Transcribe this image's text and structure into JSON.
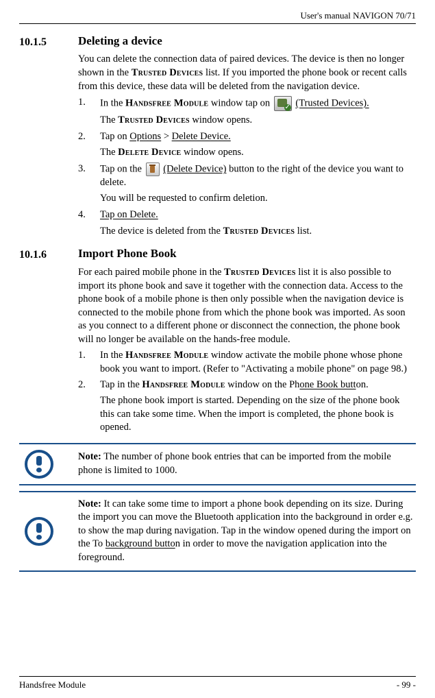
{
  "header_right": "User's manual NAVIGON 70/71",
  "sections": [
    {
      "number": "10.1.5",
      "title": "Deleting a device",
      "intro_part1": "You can delete the connection data of paired devices. The device is then no longer shown in the ",
      "intro_sc1": "Trusted Devices",
      "intro_part2": " list. If you imported the phone book or recent calls from this device, these data will be deleted from the navigation device.",
      "step1_a": "In the ",
      "step1_sc": "Handsfree Module",
      "step1_b": " window tap on ",
      "step1_link": " (Trusted Devices).",
      "step1_sub_a": "The ",
      "step1_sub_sc": "Trusted Devices",
      "step1_sub_b": " window opens.",
      "step2_a": "Tap on ",
      "step2_link1": "Options",
      "step2_gt": " > ",
      "step2_link2": "Delete Device.",
      "step2_sub_a": "The ",
      "step2_sub_sc": "Delete Device",
      "step2_sub_b": " window opens.",
      "step3_a": "Tap on the ",
      "step3_link": " (Delete Device)",
      "step3_b": " button to the right of the device you want to delete.",
      "step3_sub": "You will be requested to confirm deletion.",
      "step4_link": "Tap on Delete.",
      "step4_sub_a": "The device is deleted from the ",
      "step4_sub_sc": "Trusted Devices",
      "step4_sub_b": " list."
    },
    {
      "number": "10.1.6",
      "title": "Import Phone Book",
      "intro_a": "For each paired mobile phone in the ",
      "intro_sc": "Trusted Devices",
      "intro_b": " list it is also possible to import its phone book and save it together with the connection data. Access to the phone book of a mobile phone is then only possible when the navigation device is connected to the mobile phone from which the phone book was imported. As soon as you connect to a different phone or disconnect the connection, the phone book will no longer be available on the hands-free module.",
      "step1_a": "In the ",
      "step1_sc": "Handsfree Module",
      "step1_b": " window activate the mobile phone whose phone book you want to import. (Refer to \"Activating a mobile phone\" on page 98.)",
      "step2_a": "Tap in the ",
      "step2_sc": "Handsfree Module",
      "step2_b": " window on the Ph",
      "step2_link": "one Book butt",
      "step2_c": "on.",
      "step2_sub": "The phone book import is started. Depending on the size of the phone book this can take some time. When the import is completed, the phone book is opened."
    }
  ],
  "note1_bold": "Note:",
  "note1": " The number of phone book entries that can be imported from the mobile phone is limited to 1000.",
  "note2_bold": "Note:",
  "note2_a": " It can take some time to import a phone book depending on its size. During the import you can move the Bluetooth application into the background in order e.g. to show the map during navigation. Tap in the window opened during the import on the To ",
  "note2_link": "background butto",
  "note2_b": "n in order to move the navigation application into the foreground.",
  "footer_left": "Handsfree Module",
  "footer_right": "- 99 -"
}
